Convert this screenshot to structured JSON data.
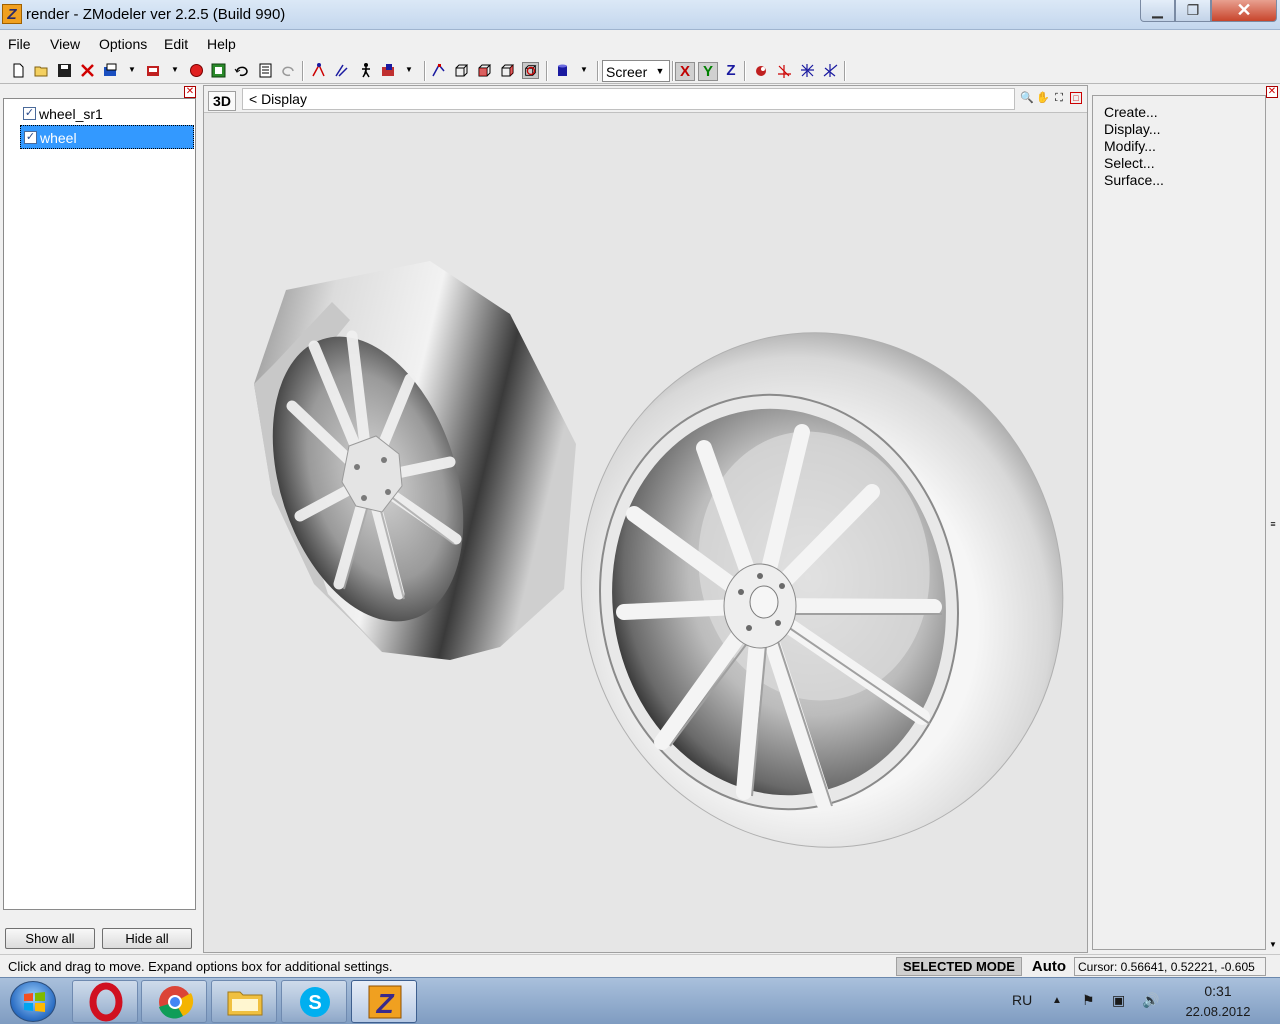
{
  "window": {
    "title": "render - ZModeler ver 2.2.5 (Build 990)",
    "app_icon_letter": "Z",
    "min_glyph": "▁",
    "max_glyph": "❐",
    "close_glyph": "✕"
  },
  "menu": [
    "File",
    "View",
    "Options",
    "Edit",
    "Help"
  ],
  "toolbar": {
    "view_select_value": "Screer",
    "axis_x": "X",
    "axis_y": "Y",
    "axis_z": "Z",
    "icons": [
      "new-file-icon",
      "open-file-icon",
      "save-icon",
      "delete-icon",
      "import-icon",
      "export-icon",
      "material-icon",
      "texture-icon",
      "undo-icon",
      "notes-icon",
      "redo-icon",
      "select-vertex-icon",
      "select-edge-icon",
      "select-object-icon",
      "transform-icon",
      "pick-icon",
      "box-view-icon",
      "front-view-icon",
      "side-view-icon",
      "perspective-view-icon",
      "camera-icon",
      "axis-icon"
    ]
  },
  "object_list": {
    "items": [
      {
        "label": "wheel_sr1",
        "checked": true,
        "selected": false
      },
      {
        "label": "wheel",
        "checked": true,
        "selected": true
      }
    ],
    "show_all_label": "Show all",
    "hide_all_label": "Hide all"
  },
  "viewport": {
    "view_label": "3D",
    "breadcrumb": "<  Display",
    "background": "#e6e6e6"
  },
  "commands": [
    "Create...",
    "Display...",
    "Modify...",
    "Select...",
    "Surface..."
  ],
  "status": {
    "message": "Click and drag to move. Expand options box for additional settings.",
    "mode": "SELECTED MODE",
    "auto": "Auto",
    "cursor": "Cursor: 0.56641, 0.52221, -0.605"
  },
  "taskbar": {
    "apps": [
      "opera",
      "chrome",
      "explorer",
      "skype",
      "zmodeler"
    ],
    "language": "RU",
    "time": "0:31",
    "date": "22.08.2012"
  }
}
